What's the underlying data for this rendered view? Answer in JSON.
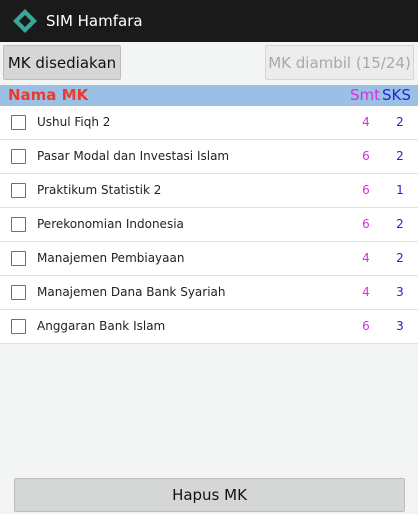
{
  "app": {
    "title": "SIM Hamfara"
  },
  "tabs": {
    "available_label": "MK disediakan",
    "taken_label": "MK diambil (15/24)"
  },
  "table": {
    "header": {
      "name": "Nama MK",
      "smt": "Smt",
      "sks": "SKS"
    },
    "rows": [
      {
        "name": "Ushul Fiqh 2",
        "smt": "4",
        "sks": "2",
        "checked": false
      },
      {
        "name": "Pasar Modal dan Investasi Islam",
        "smt": "6",
        "sks": "2",
        "checked": false
      },
      {
        "name": "Praktikum Statistik 2",
        "smt": "6",
        "sks": "1",
        "checked": false
      },
      {
        "name": "Perekonomian Indonesia",
        "smt": "6",
        "sks": "2",
        "checked": false
      },
      {
        "name": "Manajemen Pembiayaan",
        "smt": "4",
        "sks": "2",
        "checked": false
      },
      {
        "name": "Manajemen Dana Bank Syariah",
        "smt": "4",
        "sks": "3",
        "checked": false
      },
      {
        "name": "Anggaran Bank Islam",
        "smt": "6",
        "sks": "3",
        "checked": false
      }
    ]
  },
  "actions": {
    "delete_label": "Hapus MK"
  },
  "colors": {
    "actionbar": "#1a1a1a",
    "logo": "#3aa69a",
    "header_bg": "#9ac0e4",
    "name_header": "#ec3b2c",
    "smt": "#d52edd",
    "sks": "#2323d8"
  },
  "icons": {
    "app_logo": "diamond-logo-icon"
  }
}
